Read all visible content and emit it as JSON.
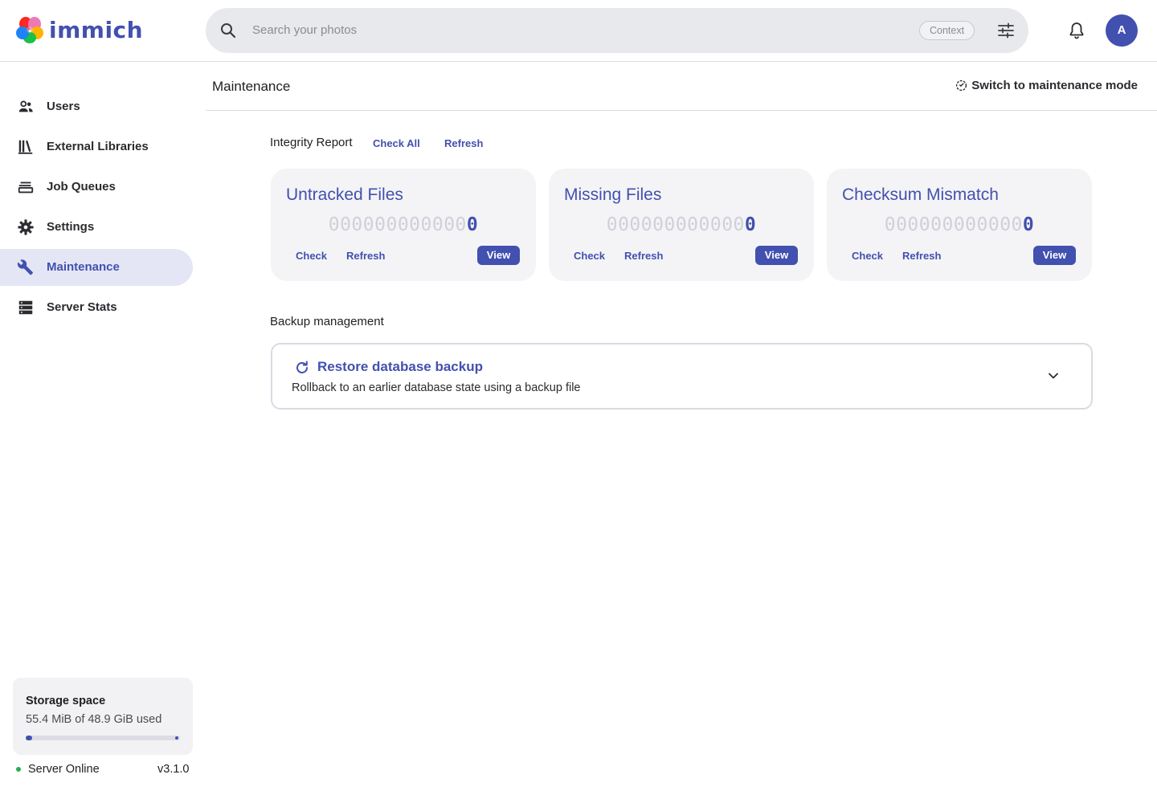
{
  "app": {
    "name": "immich"
  },
  "search": {
    "placeholder": "Search your photos",
    "context_label": "Context"
  },
  "user": {
    "avatar_initial": "A"
  },
  "sidebar": {
    "items": [
      {
        "label": "Users",
        "icon": "users-icon"
      },
      {
        "label": "External Libraries",
        "icon": "library-icon"
      },
      {
        "label": "Job Queues",
        "icon": "queue-icon"
      },
      {
        "label": "Settings",
        "icon": "gear-icon"
      },
      {
        "label": "Maintenance",
        "icon": "wrench-icon",
        "active": true
      },
      {
        "label": "Server Stats",
        "icon": "server-icon"
      }
    ],
    "storage": {
      "title": "Storage space",
      "used_text": "55.4 MiB of 48.9 GiB used",
      "used_fraction": 0.0011
    },
    "server_status": "Server Online",
    "version": "v3.1.0"
  },
  "page": {
    "title": "Maintenance",
    "switch_mode_label": "Switch to maintenance mode",
    "integrity": {
      "label": "Integrity Report",
      "check_all": "Check All",
      "refresh": "Refresh",
      "cards": [
        {
          "title": "Untracked Files",
          "padding": "000000000000",
          "count": "0",
          "check": "Check",
          "refresh": "Refresh",
          "view": "View"
        },
        {
          "title": "Missing Files",
          "padding": "000000000000",
          "count": "0",
          "check": "Check",
          "refresh": "Refresh",
          "view": "View"
        },
        {
          "title": "Checksum Mismatch",
          "padding": "000000000000",
          "count": "0",
          "check": "Check",
          "refresh": "Refresh",
          "view": "View"
        }
      ]
    },
    "backup": {
      "label": "Backup management",
      "title": "Restore database backup",
      "description": "Rollback to an earlier database state using a backup file"
    }
  },
  "colors": {
    "accent": "#4250af",
    "online": "#22b14c"
  }
}
